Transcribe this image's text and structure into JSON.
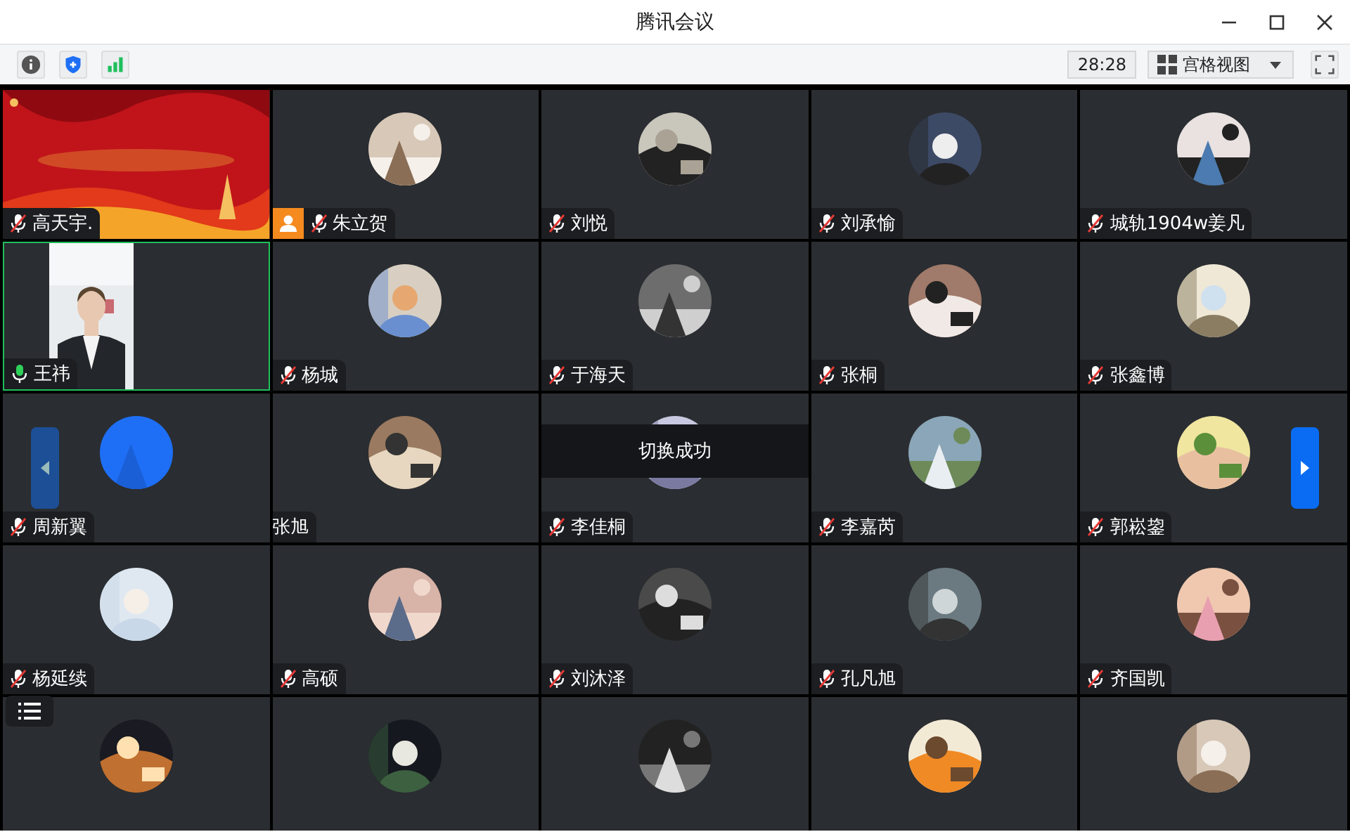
{
  "window": {
    "title": "腾讯会议"
  },
  "toolbar": {
    "timer": "28:28",
    "view_mode": "宫格视图"
  },
  "grid": {
    "tiles": [
      {
        "name": "高天宇.",
        "kind": "slide",
        "muted": true,
        "host": false,
        "speaking": false
      },
      {
        "name": "朱立贺",
        "kind": "avatar",
        "muted": true,
        "host": true,
        "speaking": false
      },
      {
        "name": "刘悦",
        "kind": "avatar",
        "muted": true,
        "host": false,
        "speaking": false
      },
      {
        "name": "刘承愉",
        "kind": "avatar",
        "muted": true,
        "host": false,
        "speaking": false
      },
      {
        "name": "城轨1904w姜凡",
        "kind": "avatar",
        "muted": true,
        "host": false,
        "speaking": false
      },
      {
        "name": "王祎",
        "kind": "video",
        "muted": false,
        "host": false,
        "speaking": true
      },
      {
        "name": "杨城",
        "kind": "avatar",
        "muted": true,
        "host": false,
        "speaking": false
      },
      {
        "name": "于海天",
        "kind": "avatar",
        "muted": true,
        "host": false,
        "speaking": false
      },
      {
        "name": "张桐",
        "kind": "avatar",
        "muted": true,
        "host": false,
        "speaking": false
      },
      {
        "name": "张鑫博",
        "kind": "avatar",
        "muted": true,
        "host": false,
        "speaking": false
      },
      {
        "name": "周新翼",
        "kind": "avatar",
        "muted": true,
        "host": false,
        "speaking": false
      },
      {
        "name": "张旭",
        "kind": "avatar",
        "host": false,
        "speaking": false
      },
      {
        "name": "李佳桐",
        "kind": "avatar",
        "muted": true,
        "host": false,
        "speaking": false
      },
      {
        "name": "李嘉芮",
        "kind": "avatar",
        "muted": true,
        "host": false,
        "speaking": false
      },
      {
        "name": "郭崧鋆",
        "kind": "avatar",
        "muted": true,
        "host": false,
        "speaking": false
      },
      {
        "name": "杨延续",
        "kind": "avatar",
        "muted": true,
        "host": false,
        "speaking": false
      },
      {
        "name": "高硕",
        "kind": "avatar",
        "muted": true,
        "host": false,
        "speaking": false
      },
      {
        "name": "刘沐泽",
        "kind": "avatar",
        "muted": true,
        "host": false,
        "speaking": false
      },
      {
        "name": "孔凡旭",
        "kind": "avatar",
        "muted": true,
        "host": false,
        "speaking": false
      },
      {
        "name": "齐国凯",
        "kind": "avatar",
        "muted": true,
        "host": false,
        "speaking": false
      },
      {
        "kind": "avatar",
        "host": false,
        "speaking": false
      },
      {
        "kind": "avatar",
        "host": false,
        "speaking": false
      },
      {
        "kind": "avatar",
        "host": false,
        "speaking": false
      },
      {
        "kind": "avatar",
        "host": false,
        "speaking": false
      },
      {
        "kind": "avatar",
        "host": false,
        "speaking": false
      }
    ]
  },
  "toast": "切换成功",
  "pager": {
    "prev_enabled": false,
    "next_enabled": true
  }
}
